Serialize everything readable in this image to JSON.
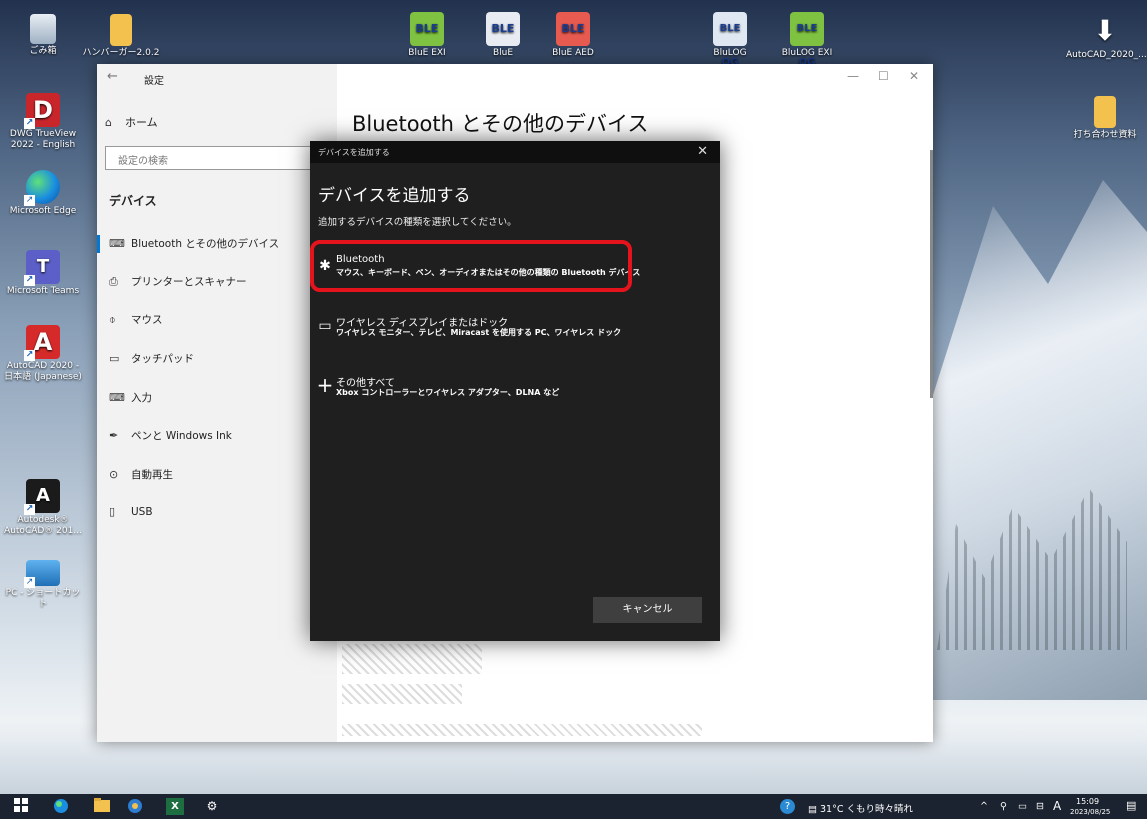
{
  "desktop": {
    "left_icons": [
      {
        "label": "ごみ箱",
        "icon": "recycle-bin-icon"
      },
      {
        "label": "DWG TrueView 2022 - English",
        "icon": "dwg-trueview-icon"
      },
      {
        "label": "Microsoft Edge",
        "icon": "edge-icon"
      },
      {
        "label": "Microsoft Teams",
        "icon": "teams-icon"
      },
      {
        "label": "AutoCAD 2020 - 日本語 (Japanese)",
        "icon": "autocad-icon"
      },
      {
        "label": "Autodesk® AutoCAD® 201...",
        "icon": "autodesk-icon"
      },
      {
        "label": "PC - ショートカット",
        "icon": "pc-icon"
      }
    ],
    "folder_label": "ハンバーガー2.0.2",
    "ble_icons": [
      {
        "label": "BLE",
        "sub": "BluE EXI"
      },
      {
        "label": "BLE",
        "sub": "BluE"
      },
      {
        "label": "BLE",
        "sub": "BluE AED"
      },
      {
        "label": "BLE OG",
        "sub": "BluLOG"
      },
      {
        "label": "BLE OG",
        "sub": "BluLOG EXI"
      }
    ],
    "right_icons": [
      {
        "label": "AutoCAD_2020_...",
        "icon": "download-arrow-icon"
      },
      {
        "label": "打ち合わせ資料",
        "icon": "folder-icon"
      }
    ]
  },
  "settings": {
    "window_title": "設定",
    "back": "←",
    "min": "—",
    "max": "☐",
    "close": "✕",
    "home_label": "ホーム",
    "search_placeholder": "設定の検索",
    "section_heading": "デバイス",
    "nav_items": [
      {
        "label": "Bluetooth とその他のデバイス",
        "icon": "bluetooth-devices-icon",
        "glyph": "⌨"
      },
      {
        "label": "プリンターとスキャナー",
        "icon": "printer-icon",
        "glyph": "⎙"
      },
      {
        "label": "マウス",
        "icon": "mouse-icon",
        "glyph": "⌽"
      },
      {
        "label": "タッチパッド",
        "icon": "touchpad-icon",
        "glyph": "▭"
      },
      {
        "label": "入力",
        "icon": "keyboard-icon",
        "glyph": "⌨"
      },
      {
        "label": "ペンと Windows Ink",
        "icon": "pen-icon",
        "glyph": "✒"
      },
      {
        "label": "自動再生",
        "icon": "autoplay-icon",
        "glyph": "⊙"
      },
      {
        "label": "USB",
        "icon": "usb-icon",
        "glyph": "▯"
      }
    ],
    "page_title": "Bluetooth とその他のデバイス"
  },
  "dialog": {
    "header_title": "デバイスを追加する",
    "close": "✕",
    "title": "デバイスを追加する",
    "subtitle": "追加するデバイスの種類を選択してください。",
    "options": [
      {
        "title": "Bluetooth",
        "desc": "マウス、キーボード、ペン、オーディオまたはその他の種類の Bluetooth デバイス",
        "glyph": "✱"
      },
      {
        "title": "ワイヤレス ディスプレイまたはドック",
        "desc": "ワイヤレス モニター、テレビ、Miracast を使用する PC、ワイヤレス ドック",
        "glyph": "▭"
      },
      {
        "title": "その他すべて",
        "desc": "Xbox コントローラーとワイヤレス アダプター、DLNA など",
        "glyph": "+"
      }
    ],
    "cancel_label": "キャンセル",
    "highlight_color": "#e5141c"
  },
  "taskbar": {
    "weather": "31°C くもり時々晴れ",
    "ime": "A",
    "time": "15:09",
    "date": "2023/08/25",
    "help": "?",
    "tray_up": "^",
    "excel": "X",
    "gear": "⚙"
  }
}
